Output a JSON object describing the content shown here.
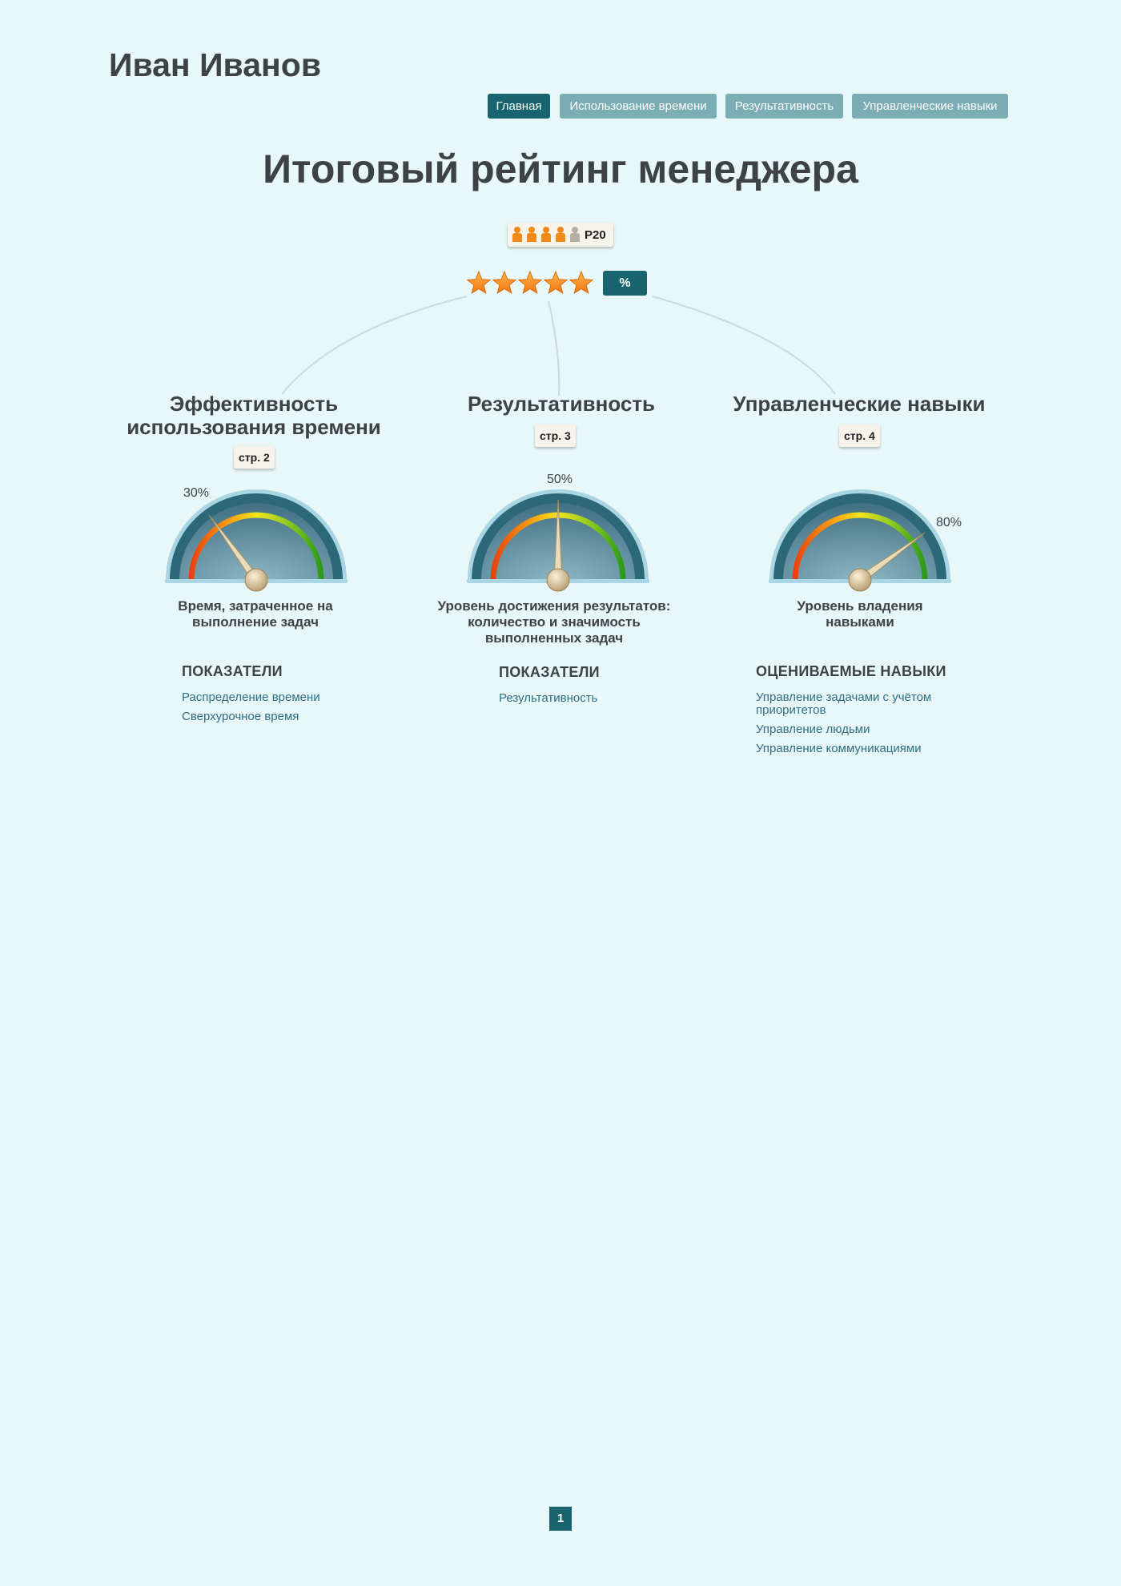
{
  "header": {
    "name": "Иван Иванов"
  },
  "nav": {
    "tabs": [
      {
        "label": "Главная",
        "active": true
      },
      {
        "label": "Использование времени",
        "active": false
      },
      {
        "label": "Результативность",
        "active": false
      },
      {
        "label": "Управленческие навыки",
        "active": false
      }
    ]
  },
  "main": {
    "title": "Итоговый рейтинг менеджера",
    "rank": {
      "label": "P20",
      "people_total": 5,
      "people_highlighted": 4,
      "highlight_color": "#f08a18",
      "dim_color": "#b6b0a4"
    },
    "stars": {
      "count": 5,
      "filled": 5,
      "color": "#f27a10"
    },
    "percent_badge": "%"
  },
  "columns": [
    {
      "title": "Эффективность использования времени",
      "page_tag": "стр. 2",
      "gauge": {
        "value": 0.3,
        "label": "30%"
      },
      "caption": "Время, затраченное на выполнение задач",
      "section_heading": "ПОКАЗАТЕЛИ",
      "links": [
        "Распределение времени",
        "Сверхурочное время"
      ]
    },
    {
      "title": "Результативность",
      "page_tag": "стр. 3",
      "gauge": {
        "value": 0.5,
        "label": "50%"
      },
      "caption": "Уровень достижения результатов: количество и значимость выполненных задач",
      "section_heading": "ПОКАЗАТЕЛИ",
      "links": [
        "Результативность"
      ]
    },
    {
      "title": "Управленческие навыки",
      "page_tag": "стр. 4",
      "gauge": {
        "value": 0.8,
        "label": "80%"
      },
      "caption": "Уровень владения навыками",
      "section_heading": "ОЦЕНИВАЕМЫЕ НАВЫКИ",
      "links": [
        "Управление задачами с учётом приоритетов",
        "Управление людьми",
        "Управление коммуникациями"
      ]
    }
  ],
  "colors": {
    "accent": "#17646e",
    "tab_inactive": "#7aaeb4",
    "link": "#2e6f86",
    "background": "#e8f7f7"
  },
  "pagination": {
    "current": "1"
  }
}
